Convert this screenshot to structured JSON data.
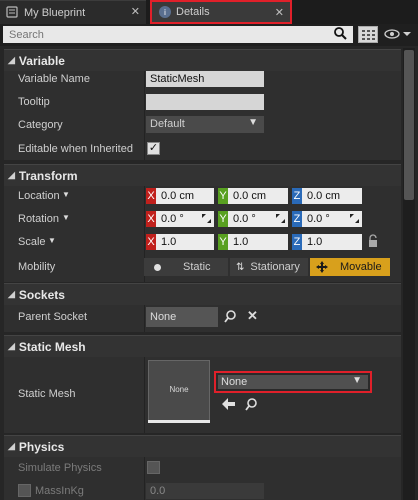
{
  "tabs": [
    {
      "label": "My Blueprint",
      "close": "✕"
    },
    {
      "label": "Details",
      "close": "✕"
    }
  ],
  "search": {
    "placeholder": "Search"
  },
  "sections": {
    "variable": {
      "title": "Variable",
      "rows": {
        "variable_name": {
          "label": "Variable Name",
          "value": "StaticMesh"
        },
        "tooltip": {
          "label": "Tooltip",
          "value": ""
        },
        "category": {
          "label": "Category",
          "value": "Default"
        },
        "editable": {
          "label": "Editable when Inherited",
          "checked": true
        }
      }
    },
    "transform": {
      "title": "Transform",
      "location": {
        "label": "Location",
        "x": "0.0 cm",
        "y": "0.0 cm",
        "z": "0.0 cm"
      },
      "rotation": {
        "label": "Rotation",
        "x": "0.0 °",
        "y": "0.0 °",
        "z": "0.0 °"
      },
      "scale": {
        "label": "Scale",
        "x": "1.0",
        "y": "1.0",
        "z": "1.0"
      },
      "axis_labels": {
        "x": "X",
        "y": "Y",
        "z": "Z"
      },
      "mobility": {
        "label": "Mobility",
        "options": [
          "Static",
          "Stationary",
          "Movable"
        ],
        "selected": "Movable"
      }
    },
    "sockets": {
      "title": "Sockets",
      "parent_socket": {
        "label": "Parent Socket",
        "value": "None"
      }
    },
    "static_mesh": {
      "title": "Static Mesh",
      "label": "Static Mesh",
      "thumbnail_text": "None",
      "value": "None"
    },
    "physics": {
      "title": "Physics",
      "simulate_physics": {
        "label": "Simulate Physics",
        "checked": false
      },
      "mass_in_kg": {
        "label": "MassInKg",
        "value": "0.0",
        "checked": false
      }
    }
  },
  "colors": {
    "highlight": "#e0202a",
    "movable": "#d8a01c",
    "axis_x": "#c0201c",
    "axis_y": "#58a020",
    "axis_z": "#2a6ab8"
  }
}
